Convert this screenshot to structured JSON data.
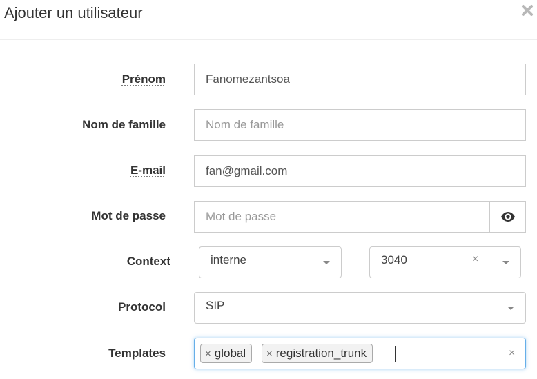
{
  "modal": {
    "title": "Ajouter un utilisateur",
    "close_icon": "close-icon"
  },
  "form": {
    "prenom": {
      "label": "Prénom",
      "value": "Fanomezantsoa"
    },
    "nom": {
      "label": "Nom de famille",
      "value": "",
      "placeholder": "Nom de famille"
    },
    "email": {
      "label": "E-mail",
      "value": "fan@gmail.com"
    },
    "password": {
      "label": "Mot de passe",
      "value": "",
      "placeholder": "Mot de passe",
      "toggle_icon": "eye-icon"
    },
    "context": {
      "label": "Context",
      "primary_value": "interne",
      "secondary_value": "3040",
      "clear_symbol": "×"
    },
    "protocol": {
      "label": "Protocol",
      "value": "SIP"
    },
    "templates": {
      "label": "Templates",
      "remove_symbol": "×",
      "tags": [
        "global",
        "registration_trunk"
      ],
      "clear_symbol": "×"
    }
  },
  "colors": {
    "focus_border": "#66afe9",
    "input_border": "#cccccc",
    "placeholder": "#999999"
  }
}
